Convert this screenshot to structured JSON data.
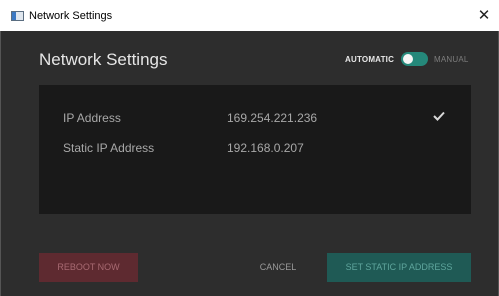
{
  "window": {
    "title": "Network Settings",
    "close_glyph": "✕"
  },
  "dialog": {
    "heading": "Network Settings",
    "mode": {
      "automatic_label": "AUTOMATIC",
      "manual_label": "MANUAL",
      "selected": "automatic"
    },
    "rows": [
      {
        "label": "IP Address",
        "value": "169.254.221.236",
        "verified": true
      },
      {
        "label": "Static IP Address",
        "value": "192.168.0.207"
      }
    ],
    "buttons": {
      "reboot": "REBOOT NOW",
      "cancel": "CANCEL",
      "set_static": "SET STATIC IP ADDRESS"
    }
  },
  "icons": {
    "app": "window-app-icon",
    "close": "close-icon",
    "check": "checkmark-icon"
  },
  "colors": {
    "background": "#2d2d2d",
    "panel": "#191919",
    "accent": "#25887a",
    "danger": "#5e2a30"
  }
}
